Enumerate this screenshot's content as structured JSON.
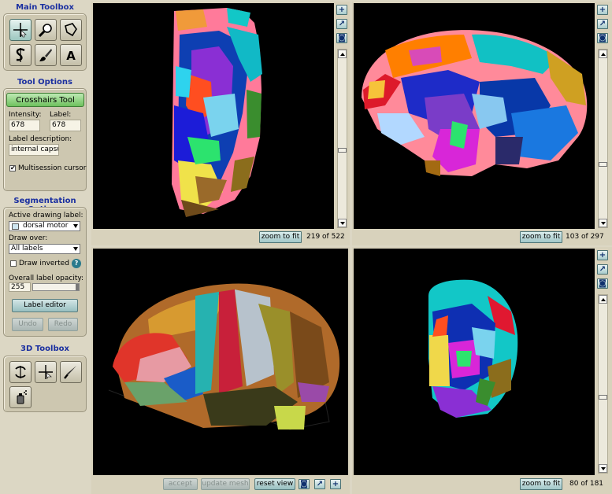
{
  "main_toolbox": {
    "title": "Main Toolbox"
  },
  "tool_options": {
    "title": "Tool Options",
    "active_tool": "Crosshairs Tool",
    "intensity_label": "Intensity:",
    "intensity_value": "678",
    "label_label": "Label:",
    "label_value": "678",
    "description_label": "Label description:",
    "description_value": "internal capsule",
    "multisession_label": "Multisession cursor",
    "multisession_checked": "✔"
  },
  "segmentation": {
    "title": "Segmentation Options",
    "active_label_caption": "Active drawing label:",
    "active_label_value": "dorsal motor",
    "active_label_color": "#cfe6f0",
    "draw_over_caption": "Draw over:",
    "draw_over_value": "All labels",
    "draw_inverted_label": "Draw inverted",
    "help": "?",
    "opacity_caption": "Overall label opacity:",
    "opacity_value": "255",
    "label_editor": "Label editor",
    "undo": "Undo",
    "redo": "Redo"
  },
  "toolbox_3d": {
    "title": "3D Toolbox"
  },
  "views": {
    "top_left": {
      "zoom": "zoom to fit",
      "slice": "219 of 522"
    },
    "top_right": {
      "zoom": "zoom to fit",
      "slice": "103 of 297"
    },
    "bottom_right": {
      "zoom": "zoom to fit",
      "slice": "80 of 181"
    },
    "view3d": {
      "accept": "accept",
      "update_mesh": "update mesh",
      "reset_view": "reset view"
    }
  },
  "colors": {
    "accent_blue": "#1a2fa0",
    "green_button": "#6fc15e",
    "background": "#dcd7c4"
  }
}
